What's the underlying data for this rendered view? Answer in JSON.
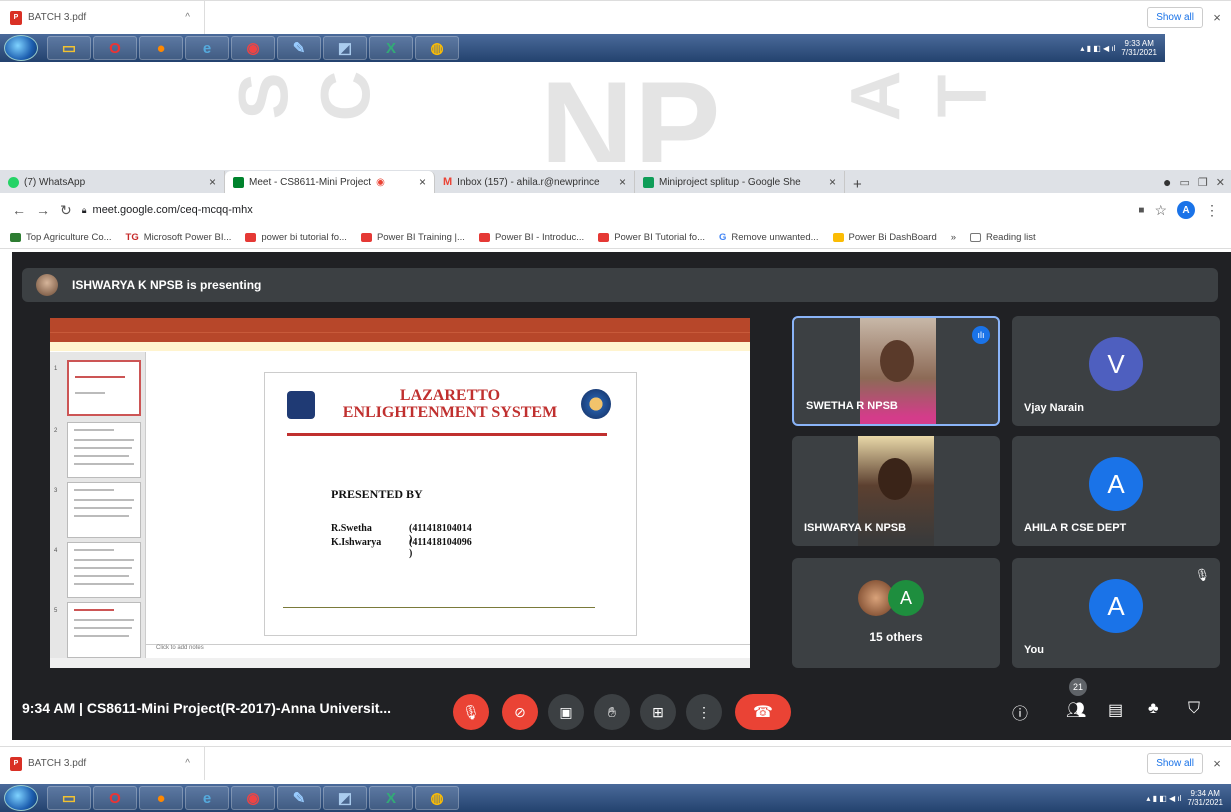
{
  "top_download": {
    "file": "BATCH 3.pdf",
    "show_all": "Show all",
    "close": "×"
  },
  "top_taskbar": {
    "time": "9:33 AM",
    "date": "7/31/2021"
  },
  "bottom_download": {
    "file": "BATCH 3.pdf",
    "show_all": "Show all",
    "close": "×"
  },
  "bottom_taskbar": {
    "time": "9:34 AM",
    "date": "7/31/2021"
  },
  "watermark": {
    "letters": "NP"
  },
  "tabs": [
    {
      "label": "(7) WhatsApp",
      "color": "#25d366"
    },
    {
      "label": "Meet - CS8611-Mini Project",
      "color": "#00832d"
    },
    {
      "label": "Inbox (157) - ahila.r@newprince",
      "color": "#ea4335"
    },
    {
      "label": "Miniproject splitup - Google She",
      "color": "#0f9d58"
    }
  ],
  "address": {
    "url": "meet.google.com/ceq-mcqq-mhx",
    "avatar": "A"
  },
  "bookmarks": [
    {
      "label": "Top Agriculture Co...",
      "color": "#2e7d32"
    },
    {
      "label": "Microsoft Power BI...",
      "color": "#e53935",
      "prefix": "TG"
    },
    {
      "label": "power bi tutorial fo...",
      "color": "#e53935"
    },
    {
      "label": "Power BI Training |...",
      "color": "#e53935"
    },
    {
      "label": "Power BI - Introduc...",
      "color": "#e53935"
    },
    {
      "label": "Power BI Tutorial fo...",
      "color": "#e53935"
    },
    {
      "label": "Remove unwanted...",
      "color": "#4285f4",
      "prefix": "G"
    },
    {
      "label": "Power Bi DashBoard",
      "color": "#fbbc04"
    },
    {
      "label": "»",
      "color": ""
    },
    {
      "label": "Reading list",
      "color": "#777"
    }
  ],
  "meet": {
    "presenting": "ISHWARYA K NPSB is presenting",
    "slide": {
      "title_line1": "LAZARETTO",
      "title_line2": "ENLIGHTENMENT SYSTEM",
      "presented_by": "PRESENTED BY",
      "presenters": [
        {
          "name": "R.Swetha",
          "id": "(411418104014 )"
        },
        {
          "name": "K.Ishwarya",
          "id": "(411418104096 )"
        }
      ],
      "notes_placeholder": "Click to add notes"
    },
    "participants": {
      "swetha": "SWETHA R NPSB",
      "vijay": "Vjay Narain",
      "vijay_initial": "V",
      "ishwarya": "ISHWARYA K NPSB",
      "ahila": "AHILA R CSE DEPT",
      "ahila_initial": "A",
      "others": "15 others",
      "others_initial": "A",
      "you": "You",
      "you_initial": "A"
    },
    "controls": {
      "meeting": "9:34 AM  |  CS8611-Mini Project(R-2017)-Anna Universit...",
      "participant_count": "21"
    }
  },
  "colors": {
    "meet_bg": "#202124",
    "tile_bg": "#3c4043",
    "accent_red": "#ea4335",
    "avatar_blue": "#1a73e8",
    "avatar_purple": "#4e5fbf",
    "avatar_green": "#1e8e3e"
  }
}
